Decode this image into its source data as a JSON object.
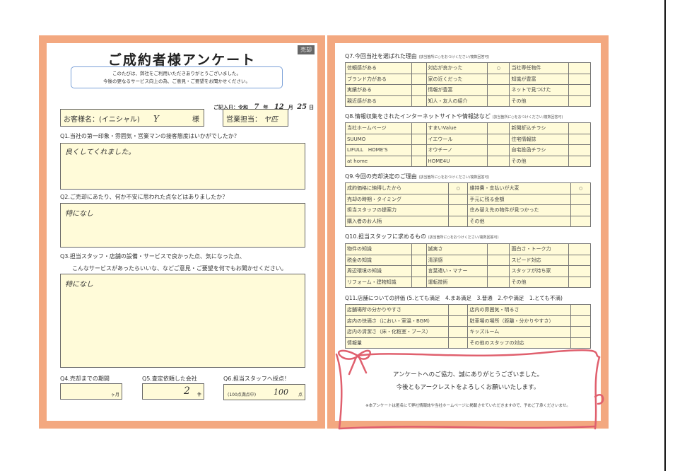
{
  "title": "ご成約者様アンケート",
  "tag": "売却",
  "greeting": [
    "このたびは、弊社をご利用いただきありがとうございました。",
    "今後の更なるサービス向上の為、ご意見・ご要望をお聞かせください。"
  ],
  "date": {
    "label": "ご記入日：令和",
    "year": "7",
    "y": "年",
    "month": "12",
    "m": "月",
    "day": "25",
    "d": "日"
  },
  "customer": {
    "label": "お客様名：(イニシャル)",
    "value": "Y",
    "suffix": "様"
  },
  "staff": {
    "label": "営業担当：",
    "value": "ヤ匹"
  },
  "q1": {
    "label": "Q1.当社の第一印象・雰囲気・営業マンの接客態度はいかがでしたか？",
    "answer": "良くしてくれました。"
  },
  "q2": {
    "label": "Q2.ご売却にあたり、何か不安に思われた点などはありましたか？",
    "answer": "特になし"
  },
  "q3": {
    "label1": "Q3.担当スタッフ・店舗の設備・サービスで良かった点、気になった点、",
    "label2": "こんなサービスがあったらいいな、などご意見・ご要望を何でもお聞かせください。",
    "answer": "特になし"
  },
  "q4": {
    "label": "Q4.売却までの期間",
    "value": "",
    "unit": "ヶ月"
  },
  "q5": {
    "label": "Q5.査定依頼した会社",
    "value": "2",
    "unit": "件"
  },
  "q6": {
    "label": "Q6.担当スタッフへ採点！",
    "note": "(100点満点中)",
    "value": "100",
    "unit": "点"
  },
  "q7": {
    "label": "Q7.今回当社を選ばれた理由",
    "hint": "(該当箇所に○をおつけください/複数回答可)",
    "cols": 3,
    "rows": [
      [
        "信頼感がある",
        "",
        "対応が良かった",
        "○",
        "当社専任物件",
        ""
      ],
      [
        "ブランド力がある",
        "",
        "家の近くだった",
        "",
        "知識が豊富",
        ""
      ],
      [
        "実績がある",
        "",
        "情報が豊富",
        "",
        "ネットで見つけた",
        ""
      ],
      [
        "親近感がある",
        "",
        "知人・友人の紹介",
        "",
        "その他",
        ""
      ]
    ]
  },
  "q8": {
    "label": "Q8.情報収集をされたインターネットサイトや情報誌など",
    "hint": "(該当箇所に○をおつけください/複数回答可)",
    "cols": 3,
    "rows": [
      [
        "当社ホームページ",
        "",
        "すまいValue",
        "",
        "新聞折込チラシ",
        ""
      ],
      [
        "SUUMO",
        "",
        "イエウール",
        "",
        "住宅情報誌",
        ""
      ],
      [
        "LIFULL　HOME'S",
        "",
        "オウチーノ",
        "",
        "自宅投函チラシ",
        ""
      ],
      [
        "at home",
        "",
        "HOME4U",
        "",
        "その他",
        ""
      ]
    ]
  },
  "q9": {
    "label": "Q9.今回の売却決定のご理由",
    "hint": "(該当箇所に○をおつけください/複数回答可)",
    "cols": 2,
    "rows": [
      [
        "成約価格に納得したから",
        "○",
        "維持費・支払いが大変",
        "○"
      ],
      [
        "売却の時期・タイミング",
        "",
        "手元に残る金額",
        ""
      ],
      [
        "担当スタッフの提案力",
        "",
        "住み替え先の物件が見つかった",
        ""
      ],
      [
        "購入者のお人柄",
        "",
        "その他",
        ""
      ]
    ]
  },
  "q10": {
    "label": "Q10.担当スタッフに求めるもの",
    "hint": "(該当箇所に○をおつけください/複数回答可)",
    "cols": 3,
    "rows": [
      [
        "物件の知識",
        "",
        "誠実さ",
        "",
        "面白さ・トーク力",
        ""
      ],
      [
        "税金の知識",
        "",
        "清潔感",
        "",
        "スピード対応",
        ""
      ],
      [
        "周辺環境の知識",
        "",
        "言葉遣い・マナー",
        "",
        "スタッフが持ち家",
        ""
      ],
      [
        "リフォーム・建物知識",
        "",
        "運転技術",
        "",
        "その他",
        ""
      ]
    ]
  },
  "q11": {
    "label": "Q11.店舗についての評価 (5.とても満足　4.まあ満足　3.普通　2.やや満足　1.とても不満)",
    "cols": 2,
    "rows": [
      [
        "店舗場所の分かりやすさ",
        "",
        "店内の雰囲気・明るさ",
        ""
      ],
      [
        "店内の快適さ（におい・室温・BGM）",
        "",
        "駐車場の場所（距離・分かりやすさ）",
        ""
      ],
      [
        "店内の清潔さ（床・化粧室・ブース）",
        "",
        "キッズルーム",
        ""
      ],
      [
        "情報量",
        "",
        "その他のスタッフの対応",
        ""
      ]
    ]
  },
  "thanks": [
    "アンケートへのご協力、誠にありがとうございました。",
    "今後ともアークレストをよろしくお願いいたします。"
  ],
  "note": "※本アンケートは匿名にて弊社情報誌や当社ホームページに掲載させていただきますので、予めご了承くださいませ。",
  "colors": {
    "frame": "#f3a880",
    "field": "#fffbd9",
    "ribbon": "#e0606e"
  }
}
